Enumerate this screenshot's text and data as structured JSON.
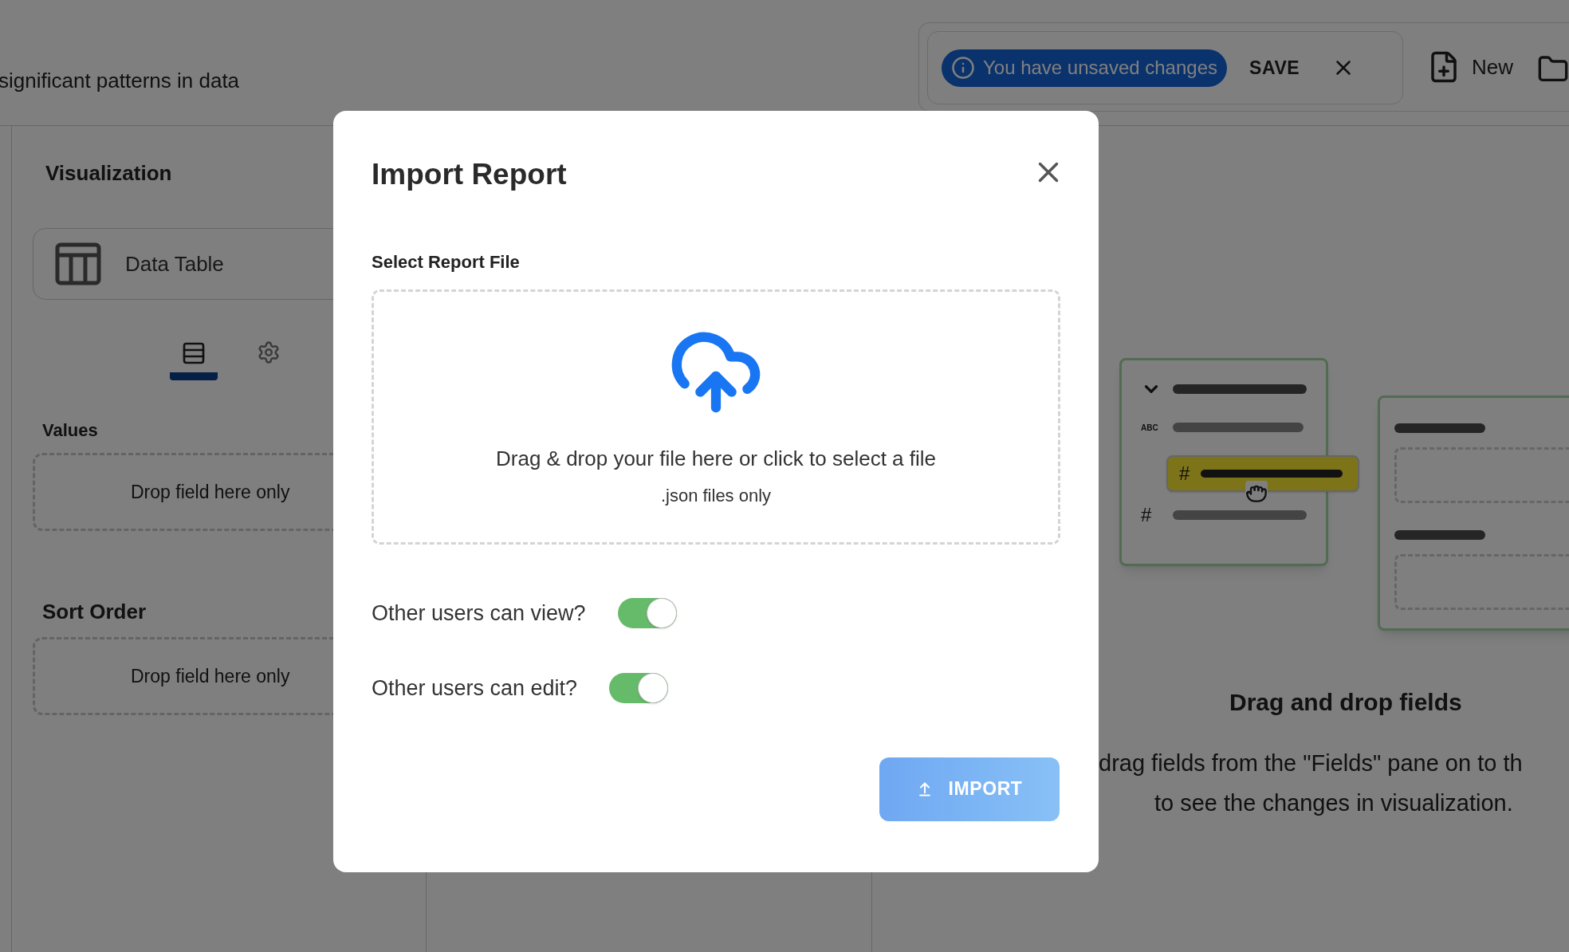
{
  "header": {
    "subtitle": "significant patterns in data"
  },
  "toolbar": {
    "unsaved_badge": "You have unsaved changes",
    "save": "SAVE",
    "new": "New"
  },
  "sidebar": {
    "title": "Visualization",
    "chart_type": "Data Table",
    "tabs": [
      {
        "kind": "fields",
        "selected": true
      },
      {
        "kind": "settings",
        "selected": false
      }
    ],
    "sections": [
      {
        "label": "Values",
        "placeholder": "Drop field here only"
      },
      {
        "label": "Sort Order",
        "placeholder": "Drop field here only"
      }
    ]
  },
  "illustration": {
    "text_type": "ABC",
    "number_type": "#",
    "dragged_type": "#"
  },
  "empty_state": {
    "title": "Drag and drop fields",
    "lines": [
      "drag fields from the \"Fields\" pane on to th",
      "to see the changes in visualization."
    ]
  },
  "modal": {
    "title": "Import Report",
    "file_label": "Select Report File",
    "dropzone": {
      "text": "Drag & drop your file here or click to select a file",
      "hint": ".json files only"
    },
    "toggles": [
      {
        "label": "Other users can view?",
        "on": true
      },
      {
        "label": "Other users can edit?",
        "on": true
      }
    ],
    "import_button": {
      "label": "IMPORT",
      "disabled": true
    }
  }
}
